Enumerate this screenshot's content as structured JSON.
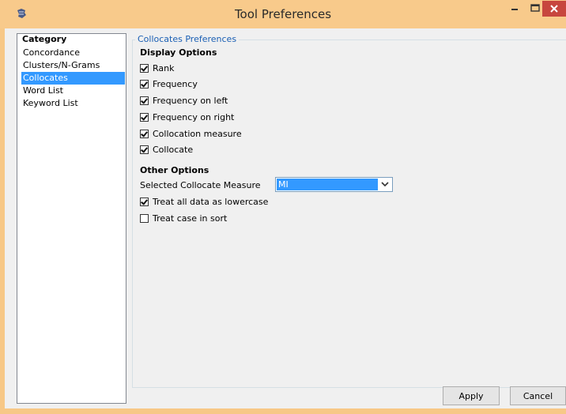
{
  "window": {
    "title": "Tool Preferences",
    "icon": "app-logo-icon",
    "controls": {
      "minimize": "minimize-icon",
      "maximize": "maximize-icon",
      "close": "close-icon"
    },
    "close_color": "#c7463e",
    "titlebar_color": "#f8ca8b"
  },
  "category": {
    "label": "Category",
    "items": [
      "Concordance",
      "Clusters/N-Grams",
      "Collocates",
      "Word List",
      "Keyword List"
    ],
    "selected": "Collocates",
    "selection_color": "#3399ff"
  },
  "preferences": {
    "group_title": "Collocates Preferences",
    "display_options": {
      "title": "Display Options",
      "items": [
        {
          "label": "Rank",
          "checked": true
        },
        {
          "label": "Frequency",
          "checked": true
        },
        {
          "label": "Frequency on left",
          "checked": true
        },
        {
          "label": "Frequency on right",
          "checked": true
        },
        {
          "label": "Collocation measure",
          "checked": true
        },
        {
          "label": "Collocate",
          "checked": true
        }
      ]
    },
    "other_options": {
      "title": "Other Options",
      "measure_label": "Selected Collocate Measure",
      "measure_value": "MI",
      "treat_lowercase": {
        "label": "Treat all data as lowercase",
        "checked": true
      },
      "treat_case_sort": {
        "label": "Treat case in sort",
        "checked": false
      }
    }
  },
  "buttons": {
    "apply": "Apply",
    "cancel": "Cancel"
  }
}
